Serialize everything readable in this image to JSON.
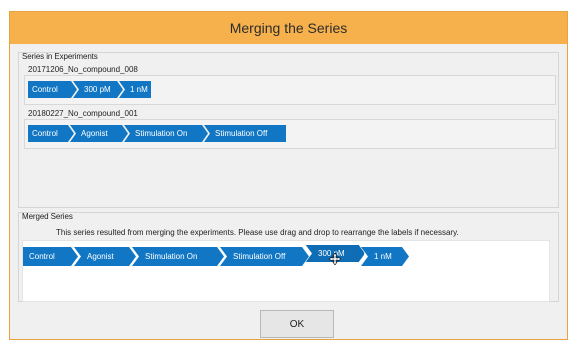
{
  "window": {
    "title": "Merging the Series"
  },
  "series_group": {
    "title": "Series in Experiments",
    "experiments": [
      {
        "name": "20171206_No_compound_008",
        "labels": [
          "Control",
          "300 pM",
          "1 nM"
        ]
      },
      {
        "name": "20180227_No_compound_001",
        "labels": [
          "Control",
          "Agonist",
          "Stimulation On",
          "Stimulation Off"
        ]
      }
    ]
  },
  "merged_group": {
    "title": "Merged Series",
    "description": "This series resulted from merging the experiments. Please use drag and drop to rearrange the labels if necessary.",
    "labels": [
      "Control",
      "Agonist",
      "Stimulation On",
      "Stimulation Off",
      "300 pM",
      "1 nM"
    ],
    "dragging_label": "300 pM"
  },
  "footer": {
    "ok_label": "OK"
  },
  "colors": {
    "title_bar": "#f6b14c",
    "tag": "#1177c4",
    "tag_text": "#ffffff",
    "dialog_bg": "#f0f0f0"
  }
}
